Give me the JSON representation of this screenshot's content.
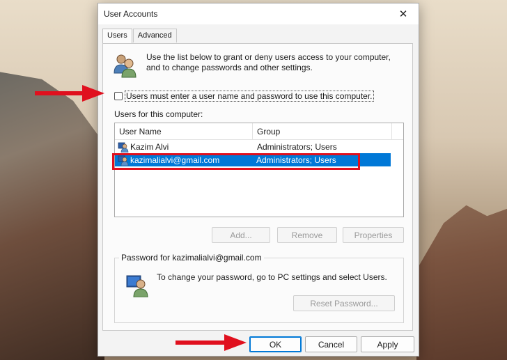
{
  "dialog": {
    "title": "User Accounts",
    "close_glyph": "✕"
  },
  "tabs": [
    {
      "label": "Users"
    },
    {
      "label": "Advanced"
    }
  ],
  "intro": {
    "icon": "users-icon",
    "text": "Use the list below to grant or deny users access to your computer, and to change passwords and other settings."
  },
  "require_login": {
    "label": "Users must enter a user name and password to use this computer.",
    "checked": false
  },
  "users_section_label": "Users for this computer:",
  "user_list": {
    "columns": [
      "User Name",
      "Group"
    ],
    "rows": [
      {
        "name": "Kazim Alvi",
        "group": "Administrators; Users",
        "selected": false
      },
      {
        "name": "kazimalialvi@gmail.com",
        "group": "Administrators; Users",
        "selected": true
      }
    ]
  },
  "list_buttons": {
    "add": "Add...",
    "remove": "Remove",
    "properties": "Properties"
  },
  "password_group": {
    "title": "Password for kazimalialvi@gmail.com",
    "text": "To change your password, go to PC settings and select Users.",
    "reset_button": "Reset Password..."
  },
  "footer": {
    "ok": "OK",
    "cancel": "Cancel",
    "apply": "Apply"
  },
  "colors": {
    "selection": "#0078d7",
    "annotation_red": "#e0101e"
  }
}
